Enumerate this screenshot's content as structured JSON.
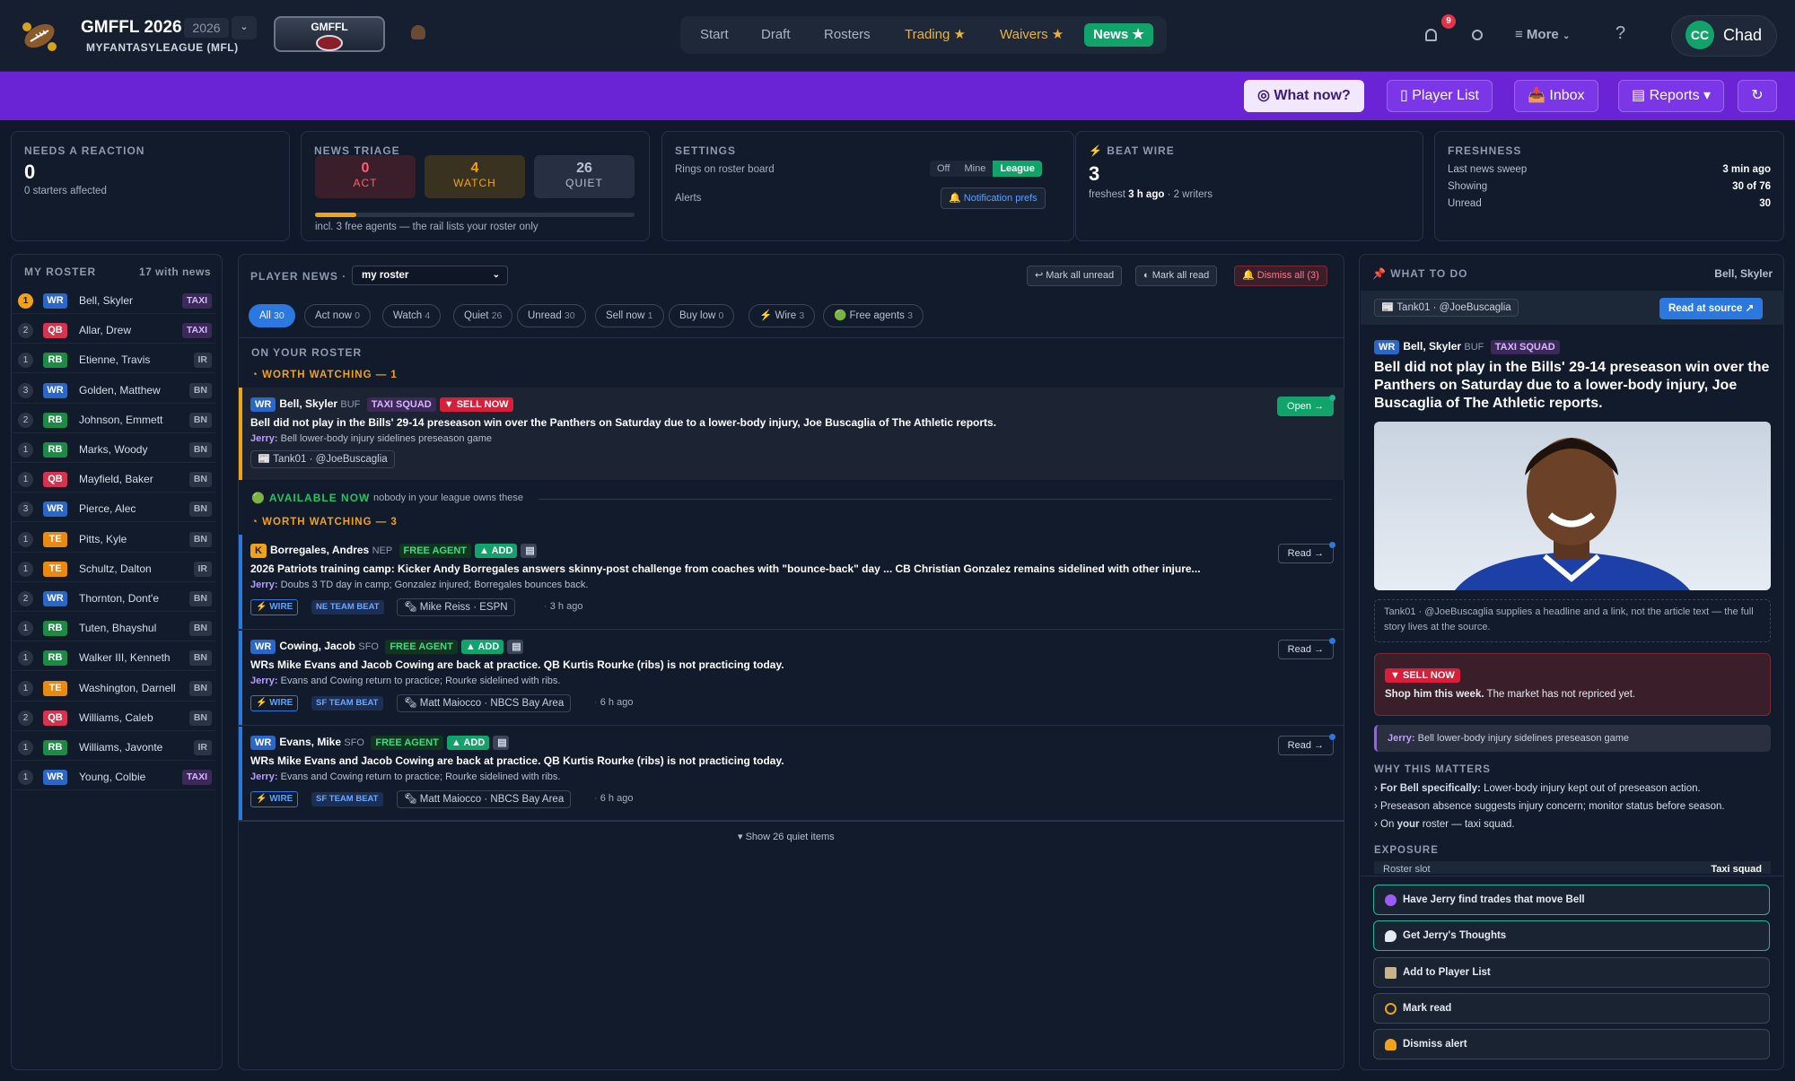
{
  "app": {
    "title": "GMFFL 2026",
    "year": "2026",
    "platform": "MYFANTASYLEAGUE (MFL)",
    "league_badge": "GMFFL",
    "user_initials": "CC",
    "user_name": "Chad",
    "notification_count": "9"
  },
  "nav": {
    "start": "Start",
    "draft": "Draft",
    "rosters": "Rosters",
    "trading": "Trading ★",
    "waivers": "Waivers ★",
    "news": "News ★",
    "more": "More"
  },
  "toolbar": {
    "what_now": "What now?",
    "player_list": "Player List",
    "inbox": "Inbox",
    "reports": "Reports ▾"
  },
  "needs": {
    "label": "NEEDS A REACTION",
    "value": "0",
    "sub": "0 starters affected"
  },
  "triage": {
    "label": "NEWS TRIAGE",
    "act_n": "0",
    "act": "ACT",
    "watch_n": "4",
    "watch": "WATCH",
    "quiet_n": "26",
    "quiet": "QUIET",
    "progress_fraction": 0.13,
    "note": "incl. 3 free agents — the rail lists your roster only"
  },
  "settings": {
    "label": "SETTINGS",
    "rings": "Rings on roster board",
    "opt_off": "Off",
    "opt_mine": "Mine",
    "opt_league": "League",
    "alerts": "Alerts",
    "notif": "🔔 Notification prefs"
  },
  "beat": {
    "label": "⚡ BEAT WIRE",
    "value": "3",
    "sub_prefix": "freshest ",
    "sub_bold": "3 h ago",
    "sub_suffix": " · 2 writers"
  },
  "fresh": {
    "label": "FRESHNESS",
    "k1": "Last news sweep",
    "v1": "3 min ago",
    "k2": "Showing",
    "v2": "30 of 76",
    "k3": "Unread",
    "v3": "30"
  },
  "roster": {
    "label": "MY ROSTER",
    "count": "17 with news",
    "players": [
      {
        "n": "1",
        "pos": "WR",
        "name": "Bell, Skyler",
        "tag": "TAXI"
      },
      {
        "n": "2",
        "pos": "QB",
        "name": "Allar, Drew",
        "tag": "TAXI"
      },
      {
        "n": "1",
        "pos": "RB",
        "name": "Etienne, Travis",
        "tag": "IR"
      },
      {
        "n": "3",
        "pos": "WR",
        "name": "Golden, Matthew",
        "tag": "BN"
      },
      {
        "n": "2",
        "pos": "RB",
        "name": "Johnson, Emmett",
        "tag": "BN"
      },
      {
        "n": "1",
        "pos": "RB",
        "name": "Marks, Woody",
        "tag": "BN"
      },
      {
        "n": "1",
        "pos": "QB",
        "name": "Mayfield, Baker",
        "tag": "BN"
      },
      {
        "n": "3",
        "pos": "WR",
        "name": "Pierce, Alec",
        "tag": "BN"
      },
      {
        "n": "1",
        "pos": "TE",
        "name": "Pitts, Kyle",
        "tag": "BN"
      },
      {
        "n": "1",
        "pos": "TE",
        "name": "Schultz, Dalton",
        "tag": "IR"
      },
      {
        "n": "2",
        "pos": "WR",
        "name": "Thornton, Dont'e",
        "tag": "BN"
      },
      {
        "n": "1",
        "pos": "RB",
        "name": "Tuten, Bhayshul",
        "tag": "BN"
      },
      {
        "n": "1",
        "pos": "RB",
        "name": "Walker III, Kenneth",
        "tag": "BN"
      },
      {
        "n": "1",
        "pos": "TE",
        "name": "Washington, Darnell",
        "tag": "BN"
      },
      {
        "n": "2",
        "pos": "QB",
        "name": "Williams, Caleb",
        "tag": "BN"
      },
      {
        "n": "1",
        "pos": "RB",
        "name": "Williams, Javonte",
        "tag": "IR"
      },
      {
        "n": "1",
        "pos": "WR",
        "name": "Young, Colbie",
        "tag": "TAXI"
      }
    ]
  },
  "news": {
    "label": "PLAYER NEWS ·",
    "scope": "my roster",
    "mark_unread": "↩ Mark all unread",
    "mark_read": "◐ Mark all read",
    "dismiss_all": "🔔 Dismiss all (3)",
    "filters": [
      {
        "l": "All",
        "n": "30"
      },
      {
        "l": "Act now",
        "n": "0"
      },
      {
        "l": "Watch",
        "n": "4"
      },
      {
        "l": "Quiet",
        "n": "26"
      },
      {
        "l": "Unread",
        "n": "30"
      },
      {
        "l": "Sell now",
        "n": "1"
      },
      {
        "l": "Buy low",
        "n": "0"
      },
      {
        "l": "⚡ Wire",
        "n": "3"
      },
      {
        "l": "🟢 Free agents",
        "n": "3"
      }
    ],
    "on_roster": "ON YOUR ROSTER",
    "worth1": "◔ WORTH WATCHING — 1",
    "available": "🟢 AVAILABLE NOW",
    "available_note": "nobody in your league owns these",
    "worth3": "◔ WORTH WATCHING — 3",
    "show_quiet": "▾ Show 26 quiet items",
    "items": [
      {
        "pos": "WR",
        "name": "Bell, Skyler",
        "team": "BUF",
        "tag1": "TAXI SQUAD",
        "tag2": "▼ SELL NOW",
        "headline": "Bell did not play in the Bills' 29-14 preseason win over the Panthers on Saturday due to a lower-body injury, Joe Buscaglia of The Athletic reports.",
        "jerry": "Bell lower-body injury sidelines preseason game",
        "source": "📰 Tank01 · @JoeBuscaglia",
        "btn": "Open →"
      },
      {
        "pos": "K",
        "name": "Borregales, Andres",
        "team": "NEP",
        "tag1": "FREE AGENT",
        "tag2": "▲ ADD",
        "headline": "2026 Patriots training camp: Kicker Andy Borregales answers skinny-post challenge from coaches with \"bounce-back\" day ... CB Christian Gonzalez remains sidelined with other injure...",
        "jerry": "Doubs 3 TD day in camp; Gonzalez injured; Borregales bounces back.",
        "wire": "⚡ WIRE",
        "beat": "NE TEAM BEAT",
        "source": "🗞 Mike Reiss · ESPN",
        "time": "3 h ago",
        "btn": "Read →"
      },
      {
        "pos": "WR",
        "name": "Cowing, Jacob",
        "team": "SFO",
        "tag1": "FREE AGENT",
        "tag2": "▲ ADD",
        "headline": "WRs Mike Evans and Jacob Cowing are back at practice. QB Kurtis Rourke (ribs) is not practicing today.",
        "jerry": "Evans and Cowing return to practice; Rourke sidelined with ribs.",
        "wire": "⚡ WIRE",
        "beat": "SF TEAM BEAT",
        "source": "🗞 Matt Maiocco · NBCS Bay Area",
        "time": "6 h ago",
        "btn": "Read →"
      },
      {
        "pos": "WR",
        "name": "Evans, Mike",
        "team": "SFO",
        "tag1": "FREE AGENT",
        "tag2": "▲ ADD",
        "headline": "WRs Mike Evans and Jacob Cowing are back at practice. QB Kurtis Rourke (ribs) is not practicing today.",
        "jerry": "Evans and Cowing return to practice; Rourke sidelined with ribs.",
        "wire": "⚡ WIRE",
        "beat": "SF TEAM BEAT",
        "source": "🗞 Matt Maiocco · NBCS Bay Area",
        "time": "6 h ago",
        "btn": "Read →"
      }
    ]
  },
  "todo": {
    "label": "WHAT TO DO",
    "player": "Bell, Skyler",
    "source": "📰 Tank01 · @JoeBuscaglia",
    "read_source": "Read at source ↗",
    "pos": "WR",
    "name": "Bell, Skyler",
    "team": "BUF",
    "tag": "TAXI SQUAD",
    "headline": "Bell did not play in the Bills' 29-14 preseason win over the Panthers on Saturday due to a lower-body injury, Joe Buscaglia of The Athletic reports.",
    "note": "Tank01 · @JoeBuscaglia supplies a headline and a link, not the article text — the full story lives at the source.",
    "sell": "▼ SELL NOW",
    "sell_bold": "Shop him this week.",
    "sell_rest": " The market has not repriced yet.",
    "jerry_label": "Jerry:",
    "jerry": "Bell lower-body injury sidelines preseason game",
    "why_label": "WHY THIS MATTERS",
    "why1_bold": "For Bell specifically:",
    "why1": " Lower-body injury kept out of preseason action.",
    "why2": "Preseason absence suggests injury concern; monitor status before season.",
    "why3_a": "On ",
    "why3_b": "your",
    "why3_c": " roster — taxi squad.",
    "exposure_label": "EXPOSURE",
    "exp_k": "Roster slot",
    "exp_v": "Taxi squad",
    "a1": "Have Jerry find trades that move Bell",
    "a2": "Get Jerry's Thoughts",
    "a3": "Add to Player List",
    "a4": "Mark read",
    "a5": "Dismiss alert"
  },
  "colors": {
    "accent_purple": "#6a24d6",
    "green": "#12a36b",
    "blue": "#2b78e0",
    "red": "#e5334a",
    "gold": "#e8b33a"
  }
}
